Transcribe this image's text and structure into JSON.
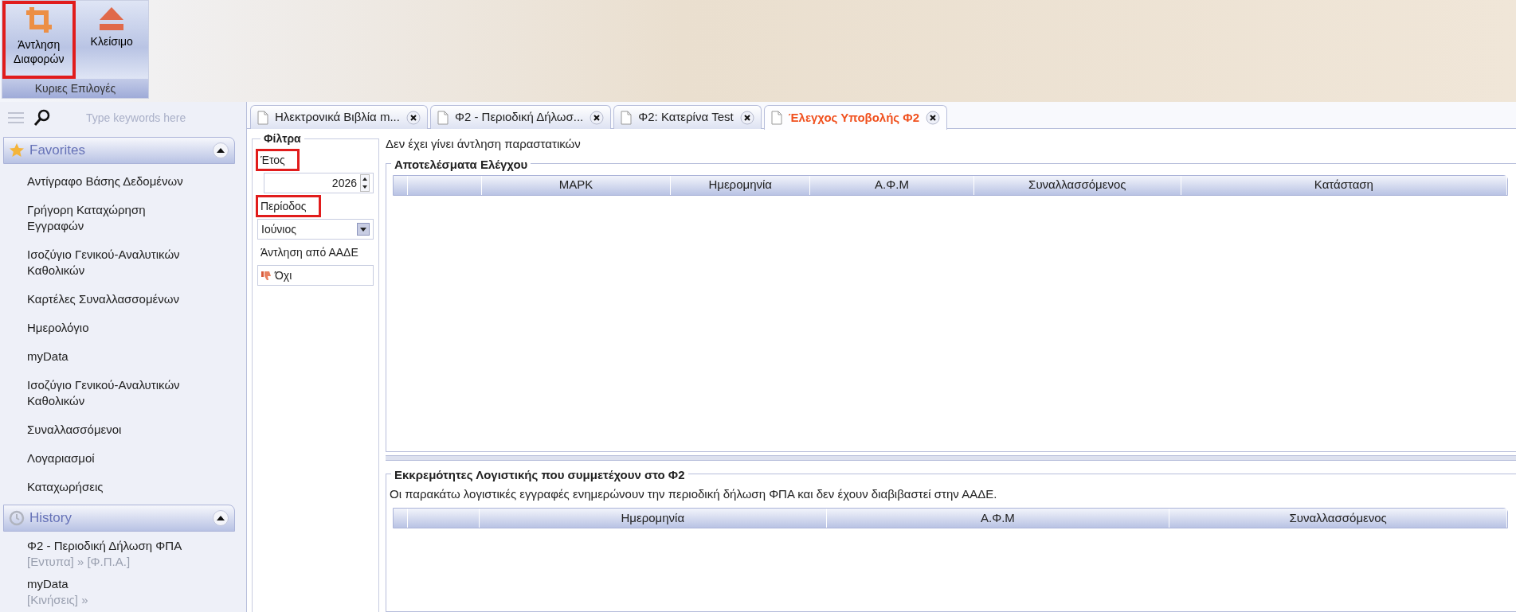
{
  "ribbon": {
    "buttons": [
      {
        "label": "Άντληση Διαφορών",
        "kind": "crop",
        "highlighted": true
      },
      {
        "label": "Κλείσιμο",
        "kind": "eject",
        "highlighted": false
      }
    ],
    "group_label": "Κυριες Επιλογές"
  },
  "sidebar": {
    "search": {
      "placeholder": "Type keywords here"
    },
    "sections": [
      {
        "title": "Favorites",
        "kind": "star",
        "expanded": true,
        "items": [
          {
            "label": "Αντίγραφο Βάσης Δεδομένων"
          },
          {
            "label": "Γρήγορη Καταχώρηση Εγγραφών"
          },
          {
            "label": "Ισοζύγιο Γενικού-Αναλυτικών Καθολικών"
          },
          {
            "label": "Καρτέλες Συναλλασσομένων"
          },
          {
            "label": "Ημερολόγιο"
          },
          {
            "label": "myData"
          },
          {
            "label": "Ισοζύγιο Γενικού-Αναλυτικών Καθολικών"
          },
          {
            "label": "Συναλλασσόμενοι"
          },
          {
            "label": "Λογαριασμοί"
          },
          {
            "label": "Καταχωρήσεις"
          }
        ]
      },
      {
        "title": "History",
        "kind": "clock",
        "expanded": true,
        "items": [
          {
            "label": "Φ2 - Περιοδική Δήλωση ΦΠΑ",
            "path": "[Εντυπα] » [Φ.Π.Α.]"
          },
          {
            "label": "myData",
            "path": "[Κινήσεις] »"
          }
        ]
      }
    ]
  },
  "tabs": [
    {
      "label": "Ηλεκτρονικά Βιβλία m...",
      "selected": false
    },
    {
      "label": "Φ2 - Περιοδική Δήλωσ...",
      "selected": false
    },
    {
      "label": "Φ2: Κατερίνα Test",
      "selected": false
    },
    {
      "label": "Έλεγχος Υποβολής Φ2",
      "selected": true
    }
  ],
  "filters": {
    "title": "Φίλτρα",
    "fields": [
      {
        "label": "Έτος",
        "kind": "spin",
        "value": "2026",
        "highlighted": true
      },
      {
        "label": "Περίοδος",
        "kind": "select",
        "value": "Ιούνιος",
        "highlighted": true
      },
      {
        "label": "Άντληση από ΑΑΔΕ",
        "kind": "toggle",
        "value": "Όχι",
        "highlighted": false
      }
    ]
  },
  "status_message": "Δεν έχει γίνει άντληση παραστατικών",
  "results": {
    "title": "Αποτελέσματα Ελέγχου",
    "columns": [
      "ΜΑΡΚ",
      "Ημερομηνία",
      "Α.Φ.Μ",
      "Συναλλασσόμενος",
      "Κατάσταση"
    ]
  },
  "pending": {
    "title": "Εκκρεμότητες Λογιστικής που συμμετέχουν στο Φ2",
    "note": "Οι παρακάτω λογιστικές εγγραφές ενημερώνουν την περιοδική δήλωση ΦΠΑ και δεν έχουν διαβιβαστεί στην ΑΑΔΕ.",
    "columns": [
      "Ημερομηνία",
      "Α.Φ.Μ",
      "Συναλλασσόμενος"
    ]
  }
}
